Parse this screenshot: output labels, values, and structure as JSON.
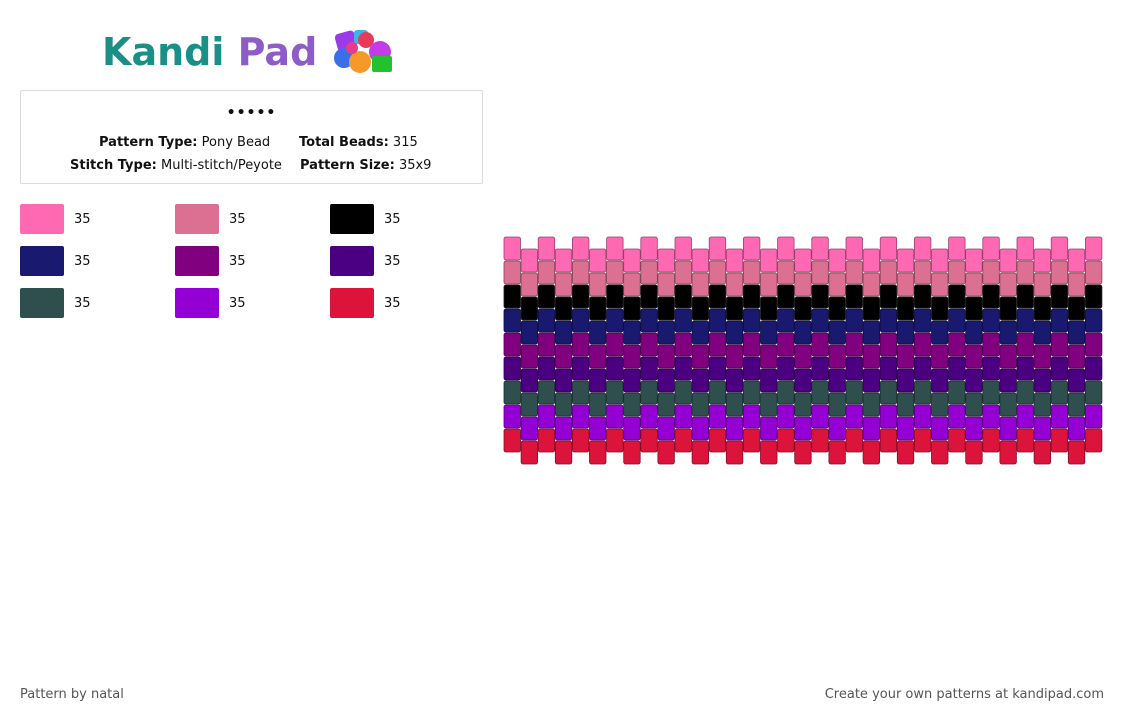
{
  "brand": {
    "name_part1": "Kandi",
    "name_part2": " Pad"
  },
  "pattern_info": {
    "title": "•••••",
    "type_label": "Pattern Type:",
    "type_value": "Pony Bead",
    "beads_label": "Total Beads:",
    "beads_value": "315",
    "stitch_label": "Stitch Type:",
    "stitch_value": "Multi-stitch/Peyote",
    "size_label": "Pattern Size:",
    "size_value": "35x9"
  },
  "palette": [
    {
      "color": "#ff69b4",
      "count": "35"
    },
    {
      "color": "#db7093",
      "count": "35"
    },
    {
      "color": "#000000",
      "count": "35"
    },
    {
      "color": "#191970",
      "count": "35"
    },
    {
      "color": "#800080",
      "count": "35"
    },
    {
      "color": "#4b0082",
      "count": "35"
    },
    {
      "color": "#2f4f4f",
      "count": "35"
    },
    {
      "color": "#9400d3",
      "count": "35"
    },
    {
      "color": "#dc143c",
      "count": "35"
    }
  ],
  "bead_grid": {
    "columns": 35,
    "rows": 9,
    "row_colors": [
      "#ff69b4",
      "#db7093",
      "#000000",
      "#191970",
      "#800080",
      "#4b0082",
      "#2f4f4f",
      "#9400d3",
      "#dc143c"
    ]
  },
  "footer": {
    "credit": "Pattern by natal",
    "cta": "Create your own patterns at kandipad.com"
  }
}
